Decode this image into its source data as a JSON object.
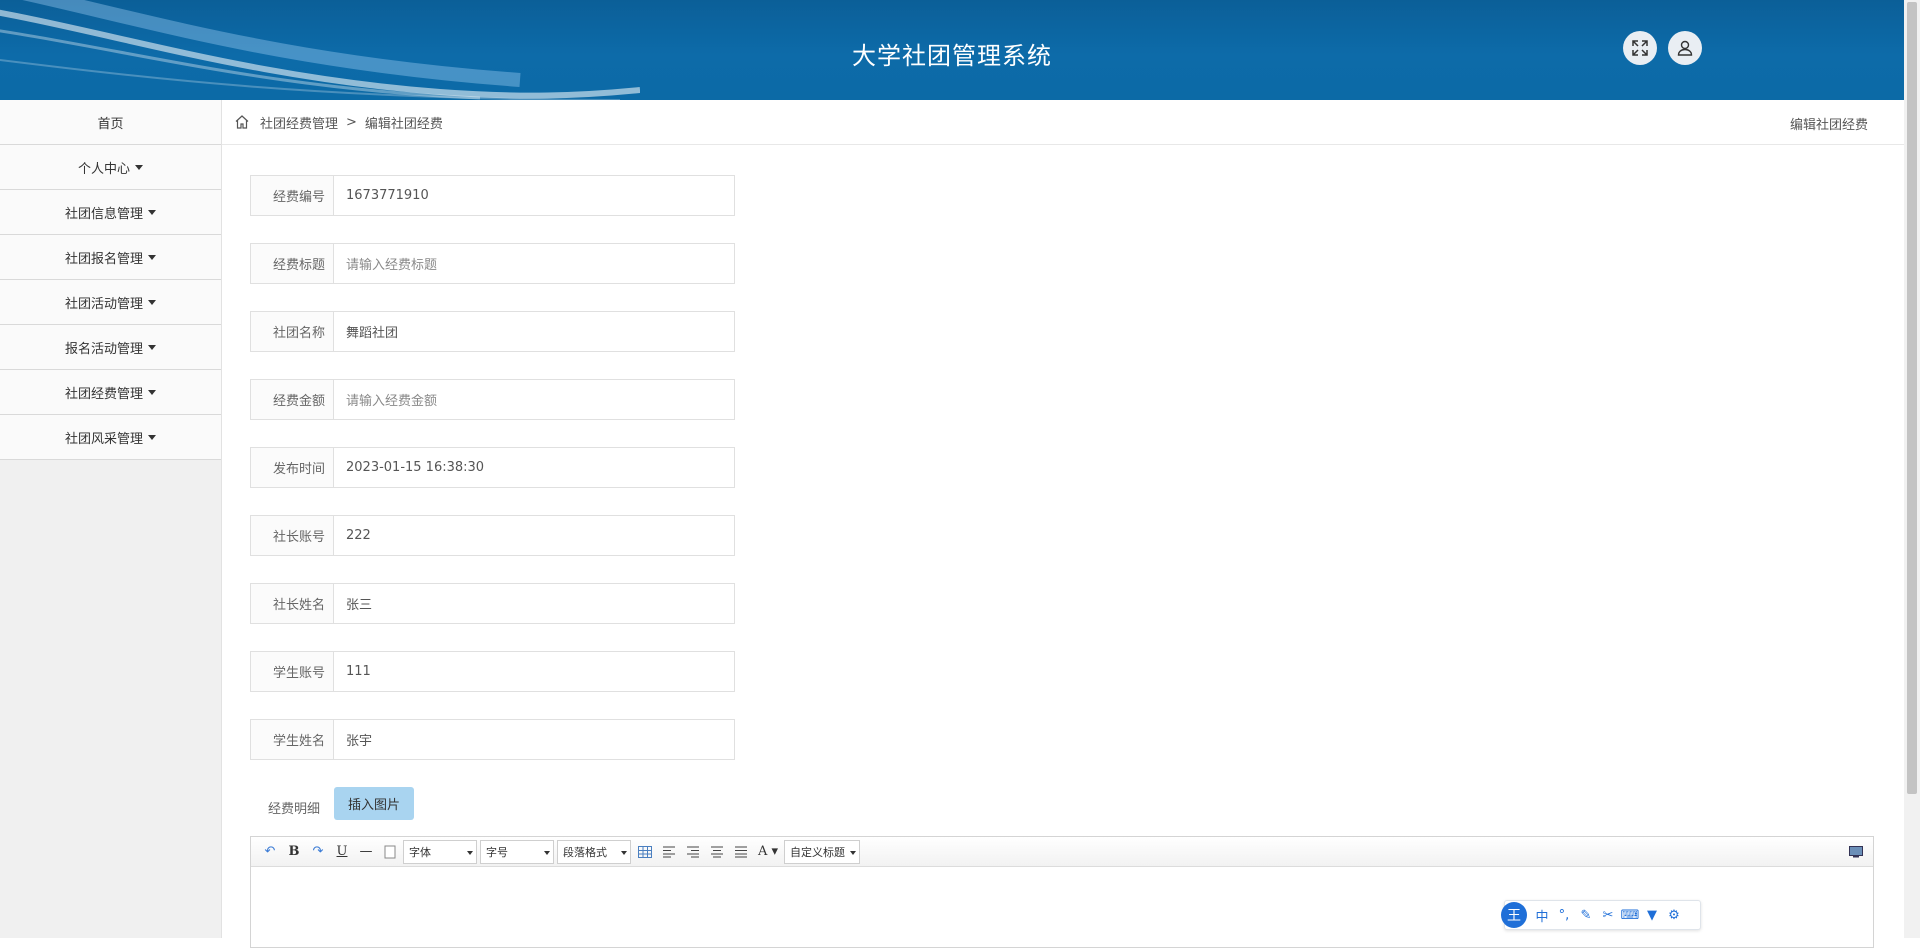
{
  "header": {
    "title": "大学社团管理系统"
  },
  "sidebar": {
    "items": [
      {
        "label": "首页",
        "dropdown": false
      },
      {
        "label": "个人中心",
        "dropdown": true
      },
      {
        "label": "社团信息管理",
        "dropdown": true
      },
      {
        "label": "社团报名管理",
        "dropdown": true
      },
      {
        "label": "社团活动管理",
        "dropdown": true
      },
      {
        "label": "报名活动管理",
        "dropdown": true
      },
      {
        "label": "社团经费管理",
        "dropdown": true
      },
      {
        "label": "社团风采管理",
        "dropdown": true
      }
    ]
  },
  "breadcrumb": {
    "parent": "社团经费管理",
    "separator": ">",
    "current": "编辑社团经费",
    "right_title": "编辑社团经费"
  },
  "form": {
    "fields": [
      {
        "label": "经费编号",
        "value": "1673771910",
        "placeholder": ""
      },
      {
        "label": "经费标题",
        "value": "",
        "placeholder": "请输入经费标题"
      },
      {
        "label": "社团名称",
        "value": "舞蹈社团",
        "placeholder": ""
      },
      {
        "label": "经费金额",
        "value": "",
        "placeholder": "请输入经费金额"
      },
      {
        "label": "发布时间",
        "value": "2023-01-15 16:38:30",
        "placeholder": ""
      },
      {
        "label": "社长账号",
        "value": "222",
        "placeholder": ""
      },
      {
        "label": "社长姓名",
        "value": "张三",
        "placeholder": ""
      },
      {
        "label": "学生账号",
        "value": "111",
        "placeholder": ""
      },
      {
        "label": "学生姓名",
        "value": "张宇",
        "placeholder": ""
      }
    ],
    "detail_label": "经费明细",
    "insert_image_label": "插入图片"
  },
  "editor": {
    "font_select": "字体",
    "size_select": "字号",
    "paragraph_select": "段落格式",
    "custom_title_select": "自定义标题"
  },
  "ime": {
    "logo": "王",
    "mode": "中"
  },
  "colors": {
    "header": "#0c6aa6",
    "accent_button": "#a9d4f0",
    "ime_blue": "#1f6fd8"
  }
}
